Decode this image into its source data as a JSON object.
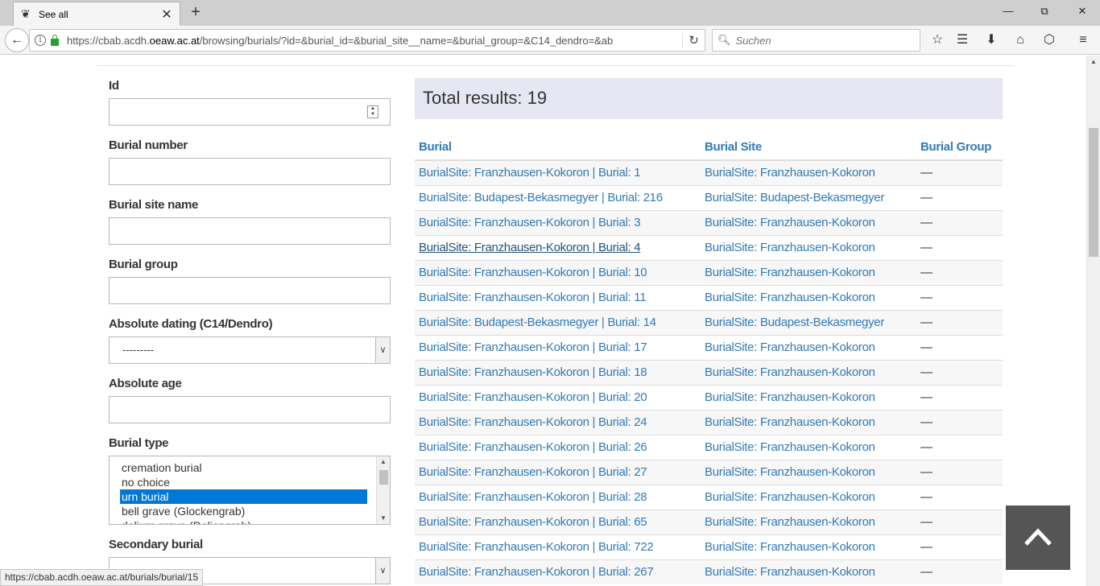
{
  "browser": {
    "tab_title": "See all",
    "tab_favicon": "cbab-logo-icon",
    "new_tab_label": "+",
    "url_prefix": "https://cbab.acdh.",
    "url_domain": "oeaw.ac.at",
    "url_path": "/browsing/burials/?id=&burial_id=&burial_site__name=&burial_group=&C14_dendro=&ab",
    "search_placeholder": "Suchen",
    "status_url": "https://cbab.acdh.oeaw.ac.at/burials/burial/15"
  },
  "filters": {
    "id_label": "Id",
    "burial_number_label": "Burial number",
    "burial_site_name_label": "Burial site name",
    "burial_group_label": "Burial group",
    "absolute_dating_label": "Absolute dating (C14/Dendro)",
    "absolute_dating_value": "---------",
    "absolute_age_label": "Absolute age",
    "burial_type_label": "Burial type",
    "burial_type_options": [
      "cremation burial",
      "no choice",
      "urn burial",
      "bell grave (Glockengrab)",
      "dolium grave (Doliengrab)"
    ],
    "burial_type_selected": "urn burial",
    "secondary_burial_label": "Secondary burial"
  },
  "results": {
    "total_label": "Total results: 19",
    "columns": [
      "Burial",
      "Burial Site",
      "Burial Group"
    ],
    "rows": [
      {
        "burial": "BurialSite: Franzhausen-Kokoron | Burial: 1",
        "site": "BurialSite: Franzhausen-Kokoron",
        "group": "—"
      },
      {
        "burial": "BurialSite: Budapest-Bekasmegyer | Burial: 216",
        "site": "BurialSite: Budapest-Bekasmegyer",
        "group": "—"
      },
      {
        "burial": "BurialSite: Franzhausen-Kokoron | Burial: 3",
        "site": "BurialSite: Franzhausen-Kokoron",
        "group": "—"
      },
      {
        "burial": "BurialSite: Franzhausen-Kokoron | Burial: 4",
        "site": "BurialSite: Franzhausen-Kokoron",
        "group": "—"
      },
      {
        "burial": "BurialSite: Franzhausen-Kokoron | Burial: 10",
        "site": "BurialSite: Franzhausen-Kokoron",
        "group": "—"
      },
      {
        "burial": "BurialSite: Franzhausen-Kokoron | Burial: 11",
        "site": "BurialSite: Franzhausen-Kokoron",
        "group": "—"
      },
      {
        "burial": "BurialSite: Budapest-Bekasmegyer | Burial: 14",
        "site": "BurialSite: Budapest-Bekasmegyer",
        "group": "—"
      },
      {
        "burial": "BurialSite: Franzhausen-Kokoron | Burial: 17",
        "site": "BurialSite: Franzhausen-Kokoron",
        "group": "—"
      },
      {
        "burial": "BurialSite: Franzhausen-Kokoron | Burial: 18",
        "site": "BurialSite: Franzhausen-Kokoron",
        "group": "—"
      },
      {
        "burial": "BurialSite: Franzhausen-Kokoron | Burial: 20",
        "site": "BurialSite: Franzhausen-Kokoron",
        "group": "—"
      },
      {
        "burial": "BurialSite: Franzhausen-Kokoron | Burial: 24",
        "site": "BurialSite: Franzhausen-Kokoron",
        "group": "—"
      },
      {
        "burial": "BurialSite: Franzhausen-Kokoron | Burial: 26",
        "site": "BurialSite: Franzhausen-Kokoron",
        "group": "—"
      },
      {
        "burial": "BurialSite: Franzhausen-Kokoron | Burial: 27",
        "site": "BurialSite: Franzhausen-Kokoron",
        "group": "—"
      },
      {
        "burial": "BurialSite: Franzhausen-Kokoron | Burial: 28",
        "site": "BurialSite: Franzhausen-Kokoron",
        "group": "—"
      },
      {
        "burial": "BurialSite: Franzhausen-Kokoron | Burial: 65",
        "site": "BurialSite: Franzhausen-Kokoron",
        "group": "—"
      },
      {
        "burial": "BurialSite: Franzhausen-Kokoron | Burial: 722",
        "site": "BurialSite: Franzhausen-Kokoron",
        "group": "—"
      },
      {
        "burial": "BurialSite: Franzhausen-Kokoron | Burial: 267",
        "site": "BurialSite: Franzhausen-Kokoron",
        "group": "—"
      }
    ],
    "hovered_row": 3
  },
  "colors": {
    "link": "#337ab7",
    "total_bg": "#e7e7f4",
    "selected_option": "#0078d7",
    "back_to_top_bg": "#555555"
  }
}
